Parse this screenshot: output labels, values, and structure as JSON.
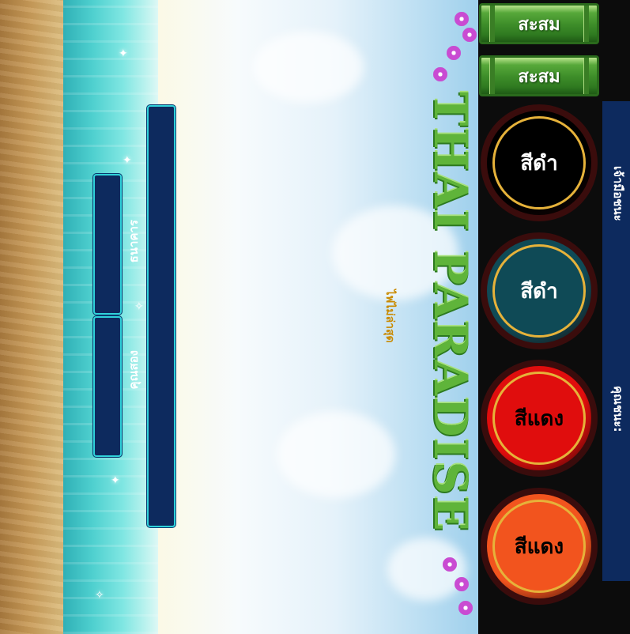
{
  "title_logo": "THAI PARADISE",
  "marquee_text": "ไฟไม่ล่าสุด",
  "left_panel": {
    "bank_label": "ธนาคาร",
    "player_label": "คุณสอง"
  },
  "buttons": {
    "accumulate_1": "สะสม",
    "accumulate_2": "สะสม"
  },
  "bets": [
    {
      "label": "สีดำ",
      "color": "#000000",
      "text_color": "#ffffff"
    },
    {
      "label": "สีดำ",
      "color": "#0f4a56",
      "text_color": "#ffffff"
    },
    {
      "label": "สีแดง",
      "color": "#e00d0d",
      "text_color": "#000000"
    },
    {
      "label": "สีแดง",
      "color": "#f2541e",
      "text_color": "#000000"
    }
  ],
  "info_panel": {
    "dealer_label": "เจ้ามือชนะ",
    "you_win_label": "คุณชนะ:"
  }
}
